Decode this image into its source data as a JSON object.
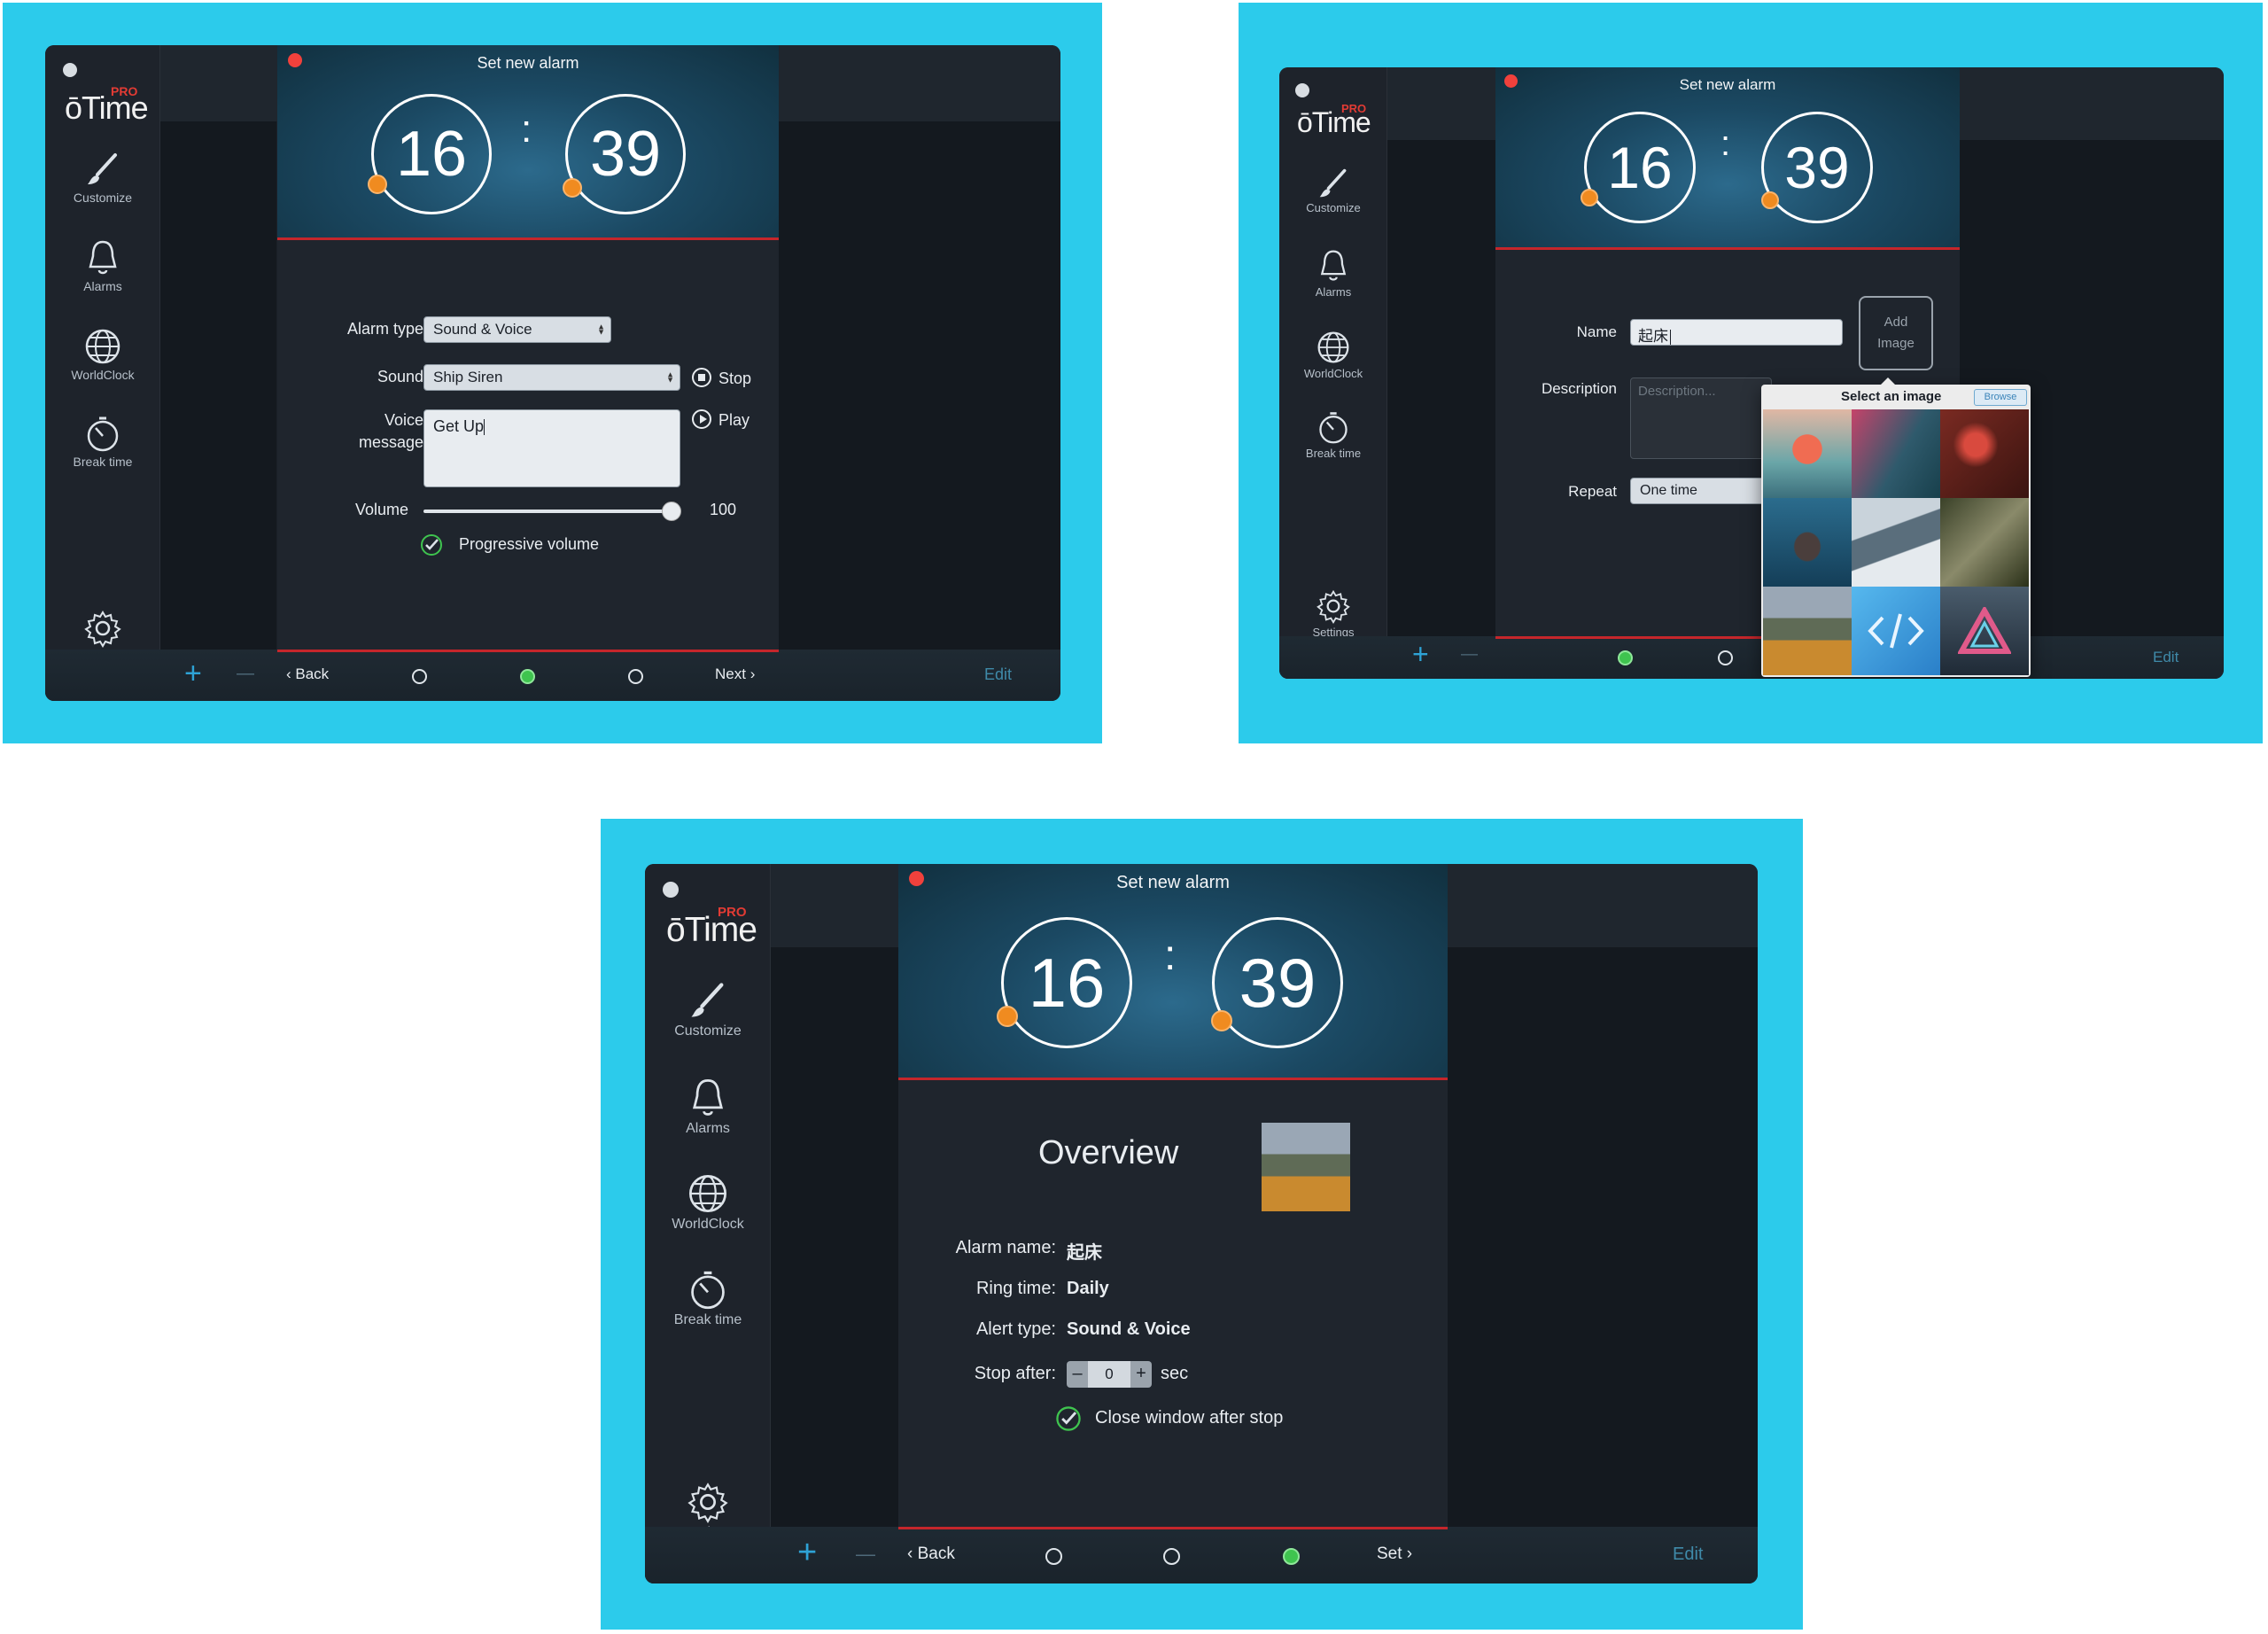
{
  "app": {
    "logo_pro": "PRO",
    "logo_name": "Time",
    "logo_prefix": "ō"
  },
  "sidebar": {
    "items": [
      {
        "label": "Customize",
        "icon": "brush-icon"
      },
      {
        "label": "Alarms",
        "icon": "bell-icon"
      },
      {
        "label": "WorldClock",
        "icon": "globe-icon"
      },
      {
        "label": "Break time",
        "icon": "stopwatch-icon"
      }
    ],
    "settings_label": "Settings"
  },
  "dialog": {
    "title": "Set new alarm",
    "hour": "16",
    "minute": "39",
    "colon": ":"
  },
  "toolbar": {
    "plus": "+",
    "minus": "—",
    "edit": "Edit"
  },
  "screen1": {
    "alarm_type_label": "Alarm type",
    "alarm_type_value": "Sound & Voice",
    "sound_label": "Sound",
    "sound_value": "Ship Siren",
    "stop_label": "Stop",
    "voice_label_1": "Voice",
    "voice_label_2": "message",
    "voice_value": "Get Up",
    "play_label": "Play",
    "volume_label": "Volume",
    "volume_value": "100",
    "volume_level": 1.0,
    "progressive_label": "Progressive volume",
    "back_label": "Back",
    "next_label": "Next",
    "active_step": 2
  },
  "screen2": {
    "name_label": "Name",
    "name_value": "起床",
    "add_image_1": "Add",
    "add_image_2": "Image",
    "description_label": "Description",
    "description_placeholder": "Description...",
    "repeat_label": "Repeat",
    "repeat_value": "One time",
    "popup_title": "Select an image",
    "browse_label": "Browse",
    "active_step": 1
  },
  "screen3": {
    "overview_title": "Overview",
    "alarm_name_label": "Alarm name:",
    "alarm_name_value": "起床",
    "ring_time_label": "Ring time:",
    "ring_time_value": "Daily",
    "alert_type_label": "Alert type:",
    "alert_type_value": "Sound & Voice",
    "stop_after_label": "Stop after:",
    "stop_after_value": "0",
    "stop_after_unit": "sec",
    "stepper_minus": "–",
    "stepper_plus": "+",
    "close_window_label": "Close window after stop",
    "back_label": "Back",
    "set_label": "Set",
    "active_step": 3
  },
  "colors": {
    "panel": "#2ccbeb",
    "accent_orange": "#f08b20",
    "accent_red": "#c5262b",
    "active_green": "#3fc44f",
    "window": "#1b2028"
  }
}
